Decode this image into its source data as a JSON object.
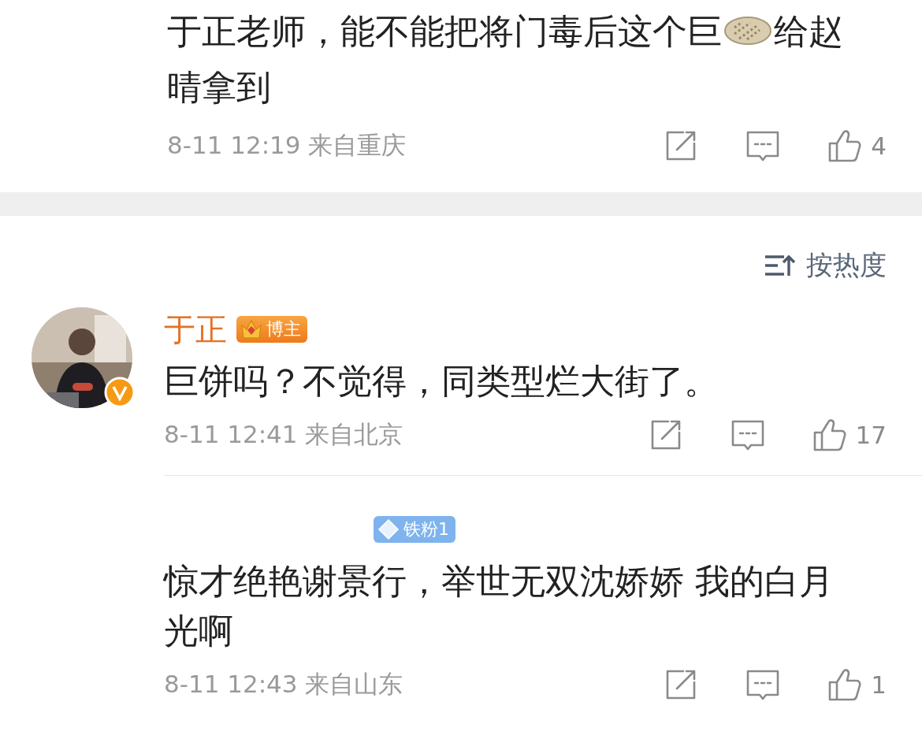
{
  "previous_comment": {
    "text_before_emoji": "于正老师，能不能把将门毒后这个巨",
    "text_after_emoji": "给赵",
    "text_line_2": "晴拿到",
    "time": "8-11 12:19",
    "location": "来自重庆",
    "likes": "4"
  },
  "sort_button": {
    "label": "按热度"
  },
  "comments": [
    {
      "name": "于正",
      "verified": true,
      "badge": {
        "kind": "blogger",
        "label": "博主"
      },
      "text": "巨饼吗？不觉得，同类型烂大街了。",
      "time": "8-11 12:41",
      "location": "来自北京",
      "likes": "17"
    },
    {
      "badge": {
        "kind": "fan",
        "label": "铁粉1"
      },
      "text": "惊才绝艳谢景行，举世无双沈娇娇 我的白月光啊",
      "time": "8-11 12:43",
      "location": "来自山东",
      "likes": "1"
    }
  ]
}
